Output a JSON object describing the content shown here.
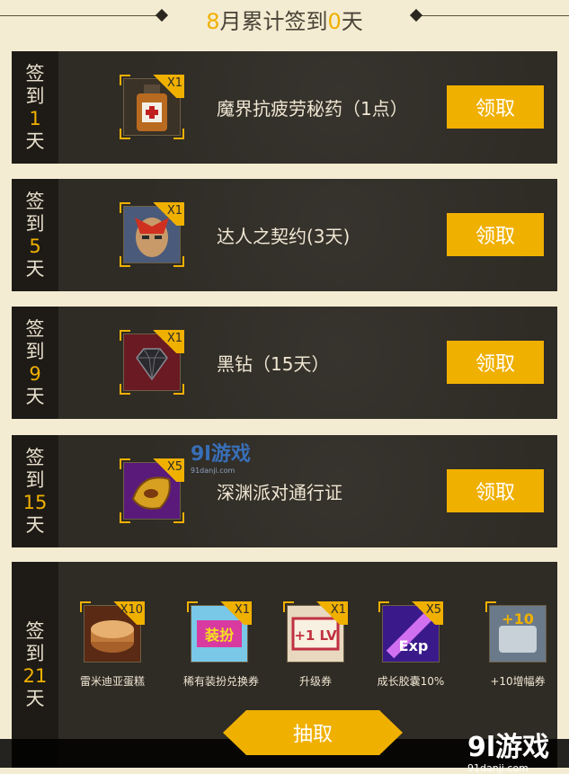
{
  "header": {
    "month": "8",
    "mid": "月累计签到",
    "count": "0",
    "suffix": "天"
  },
  "rows": [
    {
      "day_prefix": "签",
      "day_mid": "到",
      "day_num": "1",
      "day_suffix": "天",
      "qty": "X1",
      "name": "魔界抗疲劳秘药（1点）",
      "button": "领取",
      "icon": "potion-icon"
    },
    {
      "day_prefix": "签",
      "day_mid": "到",
      "day_num": "5",
      "day_suffix": "天",
      "qty": "X1",
      "name": "达人之契约(3天)",
      "button": "领取",
      "icon": "contract-icon"
    },
    {
      "day_prefix": "签",
      "day_mid": "到",
      "day_num": "9",
      "day_suffix": "天",
      "qty": "X1",
      "name": "黑钻（15天）",
      "button": "领取",
      "icon": "black-diamond-icon"
    },
    {
      "day_prefix": "签",
      "day_mid": "到",
      "day_num": "15",
      "day_suffix": "天",
      "qty": "X5",
      "name": "深渊派对通行证",
      "button": "领取",
      "icon": "abyss-pass-icon"
    }
  ],
  "big": {
    "day_prefix": "签",
    "day_mid": "到",
    "day_num": "21",
    "day_suffix": "天",
    "items": [
      {
        "qty": "X10",
        "caption": "雷米迪亚蛋糕",
        "icon": "cake-icon"
      },
      {
        "qty": "X1",
        "caption": "稀有装扮兑换券",
        "icon": "costume-coupon-icon",
        "art": "装扮"
      },
      {
        "qty": "X1",
        "caption": "升级券",
        "icon": "level-up-ticket-icon",
        "art": "+1 LV"
      },
      {
        "qty": "X5",
        "caption": "成长胶囊10%",
        "icon": "exp-capsule-icon",
        "art": "Exp"
      },
      {
        "qty": "",
        "caption": "+10增幅券",
        "icon": "amplify-ticket-icon",
        "art": "+10"
      }
    ],
    "draw_button": "抽取"
  },
  "watermark": {
    "main": "9l游戏",
    "sub": "91danji.com"
  }
}
